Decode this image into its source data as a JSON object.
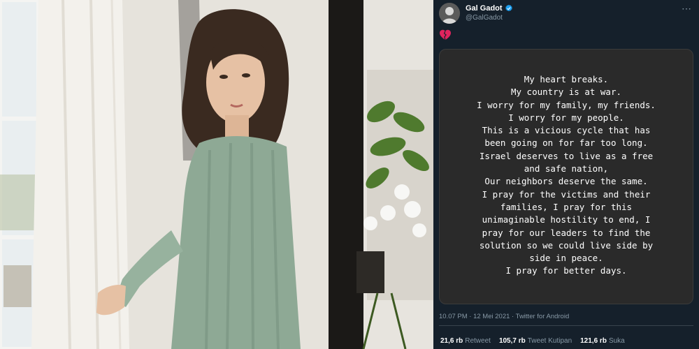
{
  "photo": {
    "alt_icon": "portrait-photo"
  },
  "tweet": {
    "author": {
      "display_name": "Gal Gadot",
      "handle": "@GalGadot",
      "verified": true
    },
    "more_icon": "more-icon",
    "emoji": "broken-heart-icon",
    "note_text": "My heart breaks.\nMy country is at war.\nI worry for my family, my friends.\nI worry for my people.\nThis is a vicious cycle that has\nbeen going on for far too long.\nIsrael deserves to live as a free\nand safe nation,\nOur neighbors deserve the same.\nI pray for the victims and their\nfamilies, I pray for this\nunimaginable hostility to end, I\npray for our leaders to find the\nsolution so we could live side by\nside in peace.\nI pray for better days.",
    "meta": "10.07 PM · 12 Mei 2021 · Twitter for Android",
    "stats": {
      "retweets": {
        "count": "21,6 rb",
        "label": "Retweet"
      },
      "quotes": {
        "count": "105,7 rb",
        "label": "Tweet Kutipan"
      },
      "likes": {
        "count": "121,6 rb",
        "label": "Suka"
      }
    }
  },
  "colors": {
    "background": "#15202b",
    "muted": "#8899a6",
    "verified": "#1da1f2",
    "heart": "#e0245e",
    "note_bg": "#2a2a2a"
  }
}
